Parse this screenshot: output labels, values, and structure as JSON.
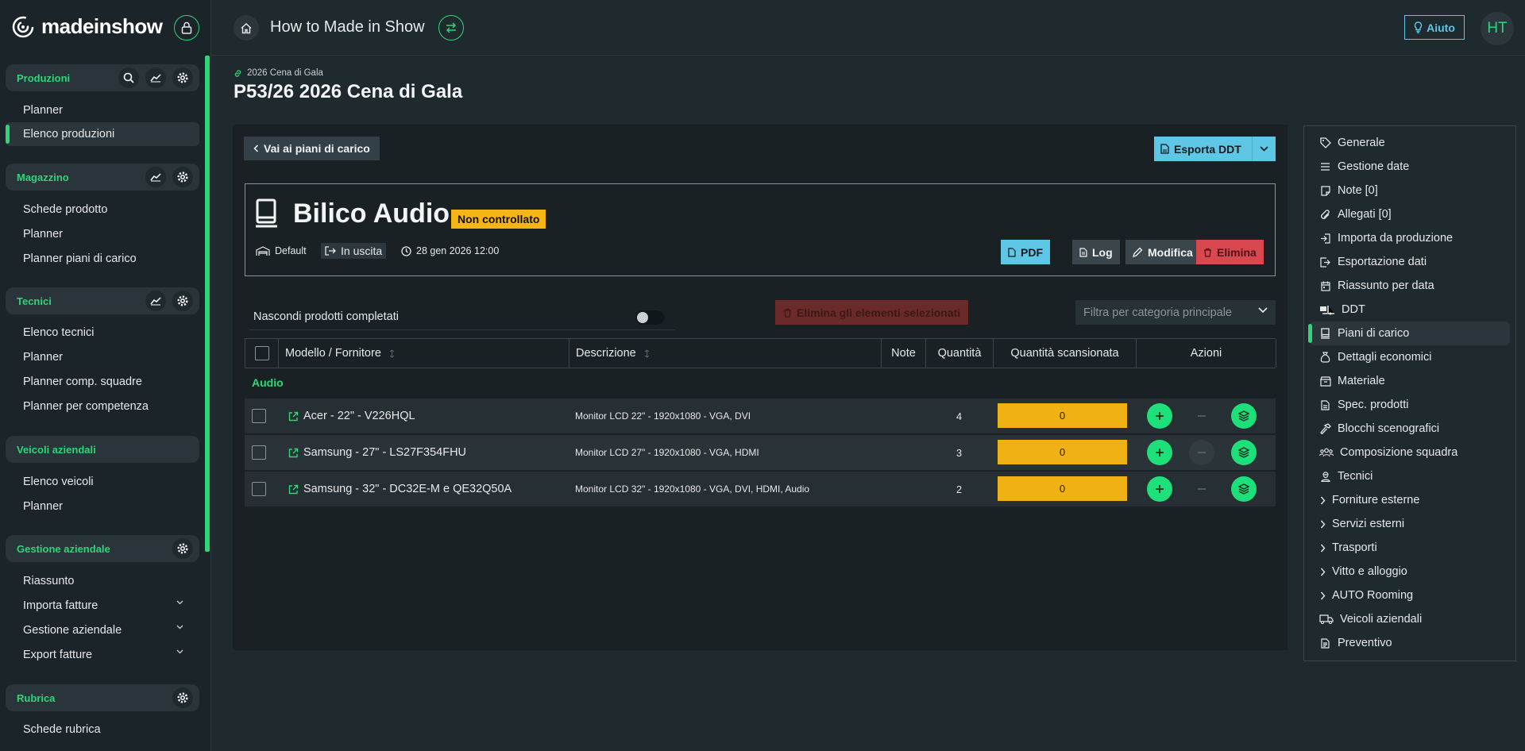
{
  "brand": {
    "name": "madeinshow"
  },
  "sidebar": {
    "sections": [
      {
        "title": "Produzioni",
        "items": [
          "Planner",
          "Elenco produzioni"
        ]
      },
      {
        "title": "Magazzino",
        "items": [
          "Schede prodotto",
          "Planner",
          "Planner piani di carico"
        ]
      },
      {
        "title": "Tecnici",
        "items": [
          "Elenco tecnici",
          "Planner",
          "Planner comp. squadre",
          "Planner per competenza"
        ]
      },
      {
        "title": "Veicoli aziendali",
        "items": [
          "Elenco veicoli",
          "Planner"
        ]
      },
      {
        "title": "Gestione aziendale",
        "items": [
          "Riassunto",
          "Importa fatture",
          "Gestione aziendale",
          "Export fatture"
        ]
      },
      {
        "title": "Rubrica",
        "items": [
          "Schede rubrica"
        ]
      }
    ]
  },
  "topbar": {
    "title": "How to Made in Show",
    "help_label": "Aiuto",
    "avatar_initials": "HT"
  },
  "header": {
    "breadcrumb": "2026 Cena di Gala",
    "title": "P53/26 2026 Cena di Gala"
  },
  "panel": {
    "back_label": "Vai ai piani di carico",
    "export_label": "Esporta DDT",
    "plan": {
      "name": "Bilico Audio",
      "status": "Non controllato",
      "warehouse": "Default",
      "direction": "In uscita",
      "datetime": "28 gen 2026 12:00",
      "buttons": {
        "pdf": "PDF",
        "log": "Log",
        "edit": "Modifica",
        "delete": "Elimina"
      }
    },
    "hide_completed_label": "Nascondi prodotti completati",
    "delete_selected_label": "Elimina gli elementi selezionati",
    "filter_placeholder": "Filtra per categoria principale",
    "table": {
      "headers": {
        "model": "Modello / Fornitore",
        "description": "Descrizione",
        "notes": "Note",
        "quantity": "Quantità",
        "scanned": "Quantità scansionata",
        "actions": "Azioni"
      },
      "group": "Audio",
      "rows": [
        {
          "model": "Acer - 22\" - V226HQL",
          "description": "Monitor LCD 22\" - 1920x1080 - VGA, DVI",
          "quantity": "4",
          "scanned": "0"
        },
        {
          "model": "Samsung - 27\" - LS27F354FHU",
          "description": "Monitor LCD 27\" - 1920x1080 - VGA, HDMI",
          "quantity": "3",
          "scanned": "0"
        },
        {
          "model": "Samsung - 32\" - DC32E-M e QE32Q50A",
          "description": "Monitor LCD 32\" - 1920x1080 - VGA, DVI, HDMI, Audio",
          "quantity": "2",
          "scanned": "0"
        }
      ]
    }
  },
  "right_nav": {
    "items": [
      {
        "label": "Generale",
        "icon": "tag-icon"
      },
      {
        "label": "Gestione date",
        "icon": "list-icon"
      },
      {
        "label": "Note [0]",
        "icon": "note-icon"
      },
      {
        "label": "Allegati [0]",
        "icon": "paperclip-icon"
      },
      {
        "label": "Importa da produzione",
        "icon": "import-icon"
      },
      {
        "label": "Esportazione dati",
        "icon": "export-icon"
      },
      {
        "label": "Riassunto per data",
        "icon": "calendar-icon"
      },
      {
        "label": "DDT",
        "icon": "truck-loading-icon"
      },
      {
        "label": "Piani di carico",
        "icon": "load-plan-icon",
        "active": true
      },
      {
        "label": "Dettagli economici",
        "icon": "money-bag-icon"
      },
      {
        "label": "Materiale",
        "icon": "box-icon"
      },
      {
        "label": "Spec. prodotti",
        "icon": "file-icon"
      },
      {
        "label": "Blocchi scenografici",
        "icon": "hammer-icon"
      },
      {
        "label": "Composizione squadra",
        "icon": "team-icon"
      },
      {
        "label": "Tecnici",
        "icon": "technician-icon"
      },
      {
        "label": "Forniture esterne",
        "icon": "chevron-right-icon"
      },
      {
        "label": "Servizi esterni",
        "icon": "chevron-right-icon"
      },
      {
        "label": "Trasporti",
        "icon": "chevron-right-icon"
      },
      {
        "label": "Vitto e alloggio",
        "icon": "chevron-right-icon"
      },
      {
        "label": "AUTO Rooming",
        "icon": "chevron-right-icon"
      },
      {
        "label": "Veicoli aziendali",
        "icon": "truck-icon"
      },
      {
        "label": "Preventivo",
        "icon": "document-icon"
      }
    ]
  },
  "colors": {
    "accent": "#2fd576",
    "info": "#5ec7e6",
    "warning": "#f5b517",
    "danger": "#d9484f",
    "bg": "#1f2a2f"
  }
}
